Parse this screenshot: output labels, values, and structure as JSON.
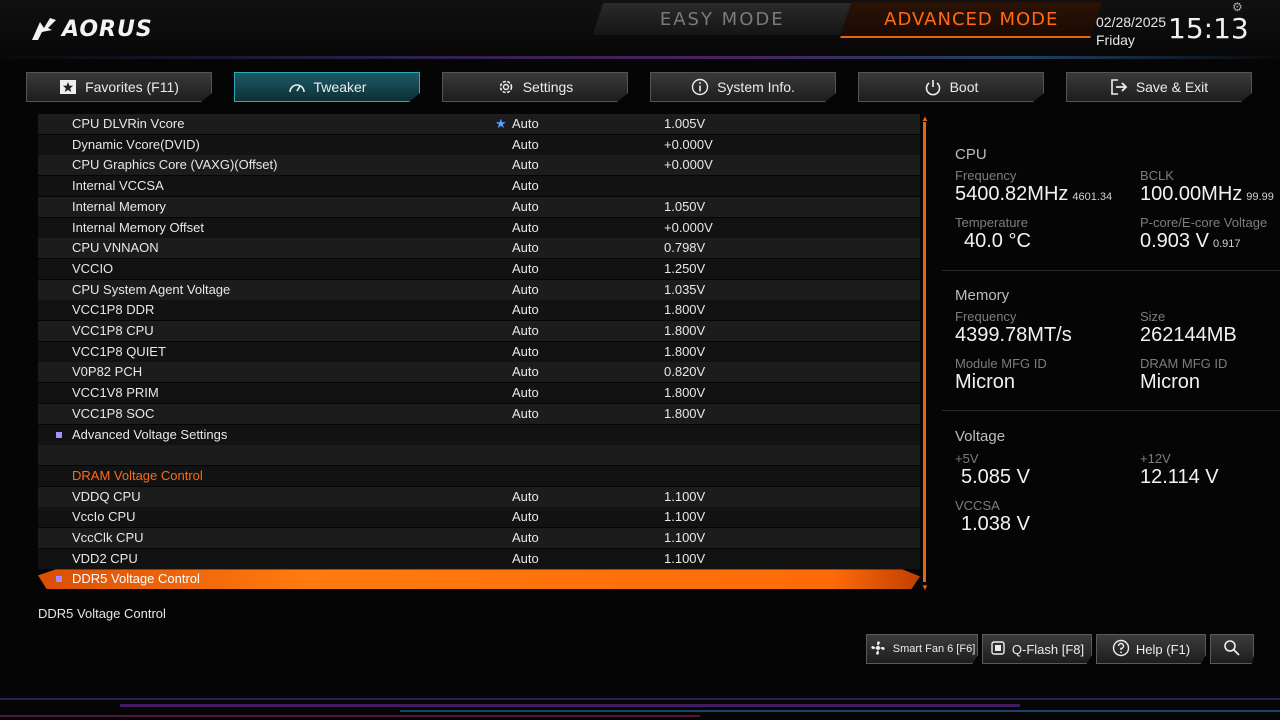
{
  "header": {
    "logo_text": "AORUS",
    "mode_easy": "EASY MODE",
    "mode_advanced": "ADVANCED MODE",
    "date": "02/28/2025",
    "day": "Friday",
    "time": "15:13"
  },
  "tabs": [
    {
      "label": "Favorites (F11)",
      "icon": "star-icon"
    },
    {
      "label": "Tweaker",
      "icon": "speedometer-icon",
      "active": true
    },
    {
      "label": "Settings",
      "icon": "gear-icon"
    },
    {
      "label": "System Info.",
      "icon": "info-icon"
    },
    {
      "label": "Boot",
      "icon": "power-icon"
    },
    {
      "label": "Save & Exit",
      "icon": "exit-icon"
    }
  ],
  "settings": [
    {
      "label": "CPU DLVRin Vcore",
      "option": "Auto",
      "value": "1.005V",
      "favorite": true
    },
    {
      "label": "Dynamic Vcore(DVID)",
      "option": "Auto",
      "value": "+0.000V"
    },
    {
      "label": "CPU Graphics Core (VAXG)(Offset)",
      "option": "Auto",
      "value": "+0.000V"
    },
    {
      "label": "Internal VCCSA",
      "option": "Auto",
      "value": ""
    },
    {
      "label": "Internal Memory",
      "option": "Auto",
      "value": "1.050V"
    },
    {
      "label": "Internal Memory Offset",
      "option": "Auto",
      "value": "+0.000V"
    },
    {
      "label": "CPU VNNAON",
      "option": "Auto",
      "value": "0.798V"
    },
    {
      "label": "VCCIO",
      "option": "Auto",
      "value": "1.250V"
    },
    {
      "label": "CPU System Agent Voltage",
      "option": "Auto",
      "value": "1.035V"
    },
    {
      "label": "VCC1P8 DDR",
      "option": "Auto",
      "value": "1.800V"
    },
    {
      "label": "VCC1P8 CPU",
      "option": "Auto",
      "value": "1.800V"
    },
    {
      "label": "VCC1P8 QUIET",
      "option": "Auto",
      "value": "1.800V"
    },
    {
      "label": "V0P82 PCH",
      "option": "Auto",
      "value": "0.820V"
    },
    {
      "label": "VCC1V8 PRIM",
      "option": "Auto",
      "value": "1.800V"
    },
    {
      "label": "VCC1P8 SOC",
      "option": "Auto",
      "value": "1.800V"
    },
    {
      "label": "Advanced Voltage Settings",
      "option": "",
      "value": "",
      "submenu": true
    },
    {
      "label": "",
      "option": "",
      "value": ""
    },
    {
      "label": "DRAM Voltage Control",
      "option": "",
      "value": "",
      "section": true
    },
    {
      "label": "VDDQ CPU",
      "option": "Auto",
      "value": "1.100V"
    },
    {
      "label": "VccIo CPU",
      "option": "Auto",
      "value": "1.100V"
    },
    {
      "label": "VccClk CPU",
      "option": "Auto",
      "value": "1.100V"
    },
    {
      "label": "VDD2 CPU",
      "option": "Auto",
      "value": "1.100V"
    },
    {
      "label": "DDR5 Voltage Control",
      "option": "",
      "value": "",
      "submenu": true,
      "selected": true
    }
  ],
  "help_text": "DDR5 Voltage Control",
  "panel": {
    "cpu": {
      "title": "CPU",
      "frequency_label": "Frequency",
      "frequency": "5400.82MHz",
      "frequency_sub": "4601.34",
      "bclk_label": "BCLK",
      "bclk": "100.00MHz",
      "bclk_sub": "99.99",
      "temperature_label": "Temperature",
      "temperature": "40.0 °C",
      "voltage_label": "P-core/E-core Voltage",
      "voltage": "0.903 V",
      "voltage_sub": "0.917"
    },
    "memory": {
      "title": "Memory",
      "frequency_label": "Frequency",
      "frequency": "4399.78MT/s",
      "size_label": "Size",
      "size": "262144MB",
      "module_label": "Module MFG ID",
      "module": "Micron",
      "dram_label": "DRAM MFG ID",
      "dram": "Micron"
    },
    "voltage": {
      "title": "Voltage",
      "v5_label": "+5V",
      "v5": "5.085 V",
      "v12_label": "+12V",
      "v12": "12.114 V",
      "vccsa_label": "VCCSA",
      "vccsa": "1.038 V"
    }
  },
  "bottom_buttons": {
    "smartfan": "Smart Fan 6 [F6]",
    "qflash": "Q-Flash [F8]",
    "help": "Help (F1)"
  },
  "colors": {
    "accent": "#ff6a12",
    "tab_active": "#1d5a66",
    "favorite_star": "#5aa0ff"
  }
}
